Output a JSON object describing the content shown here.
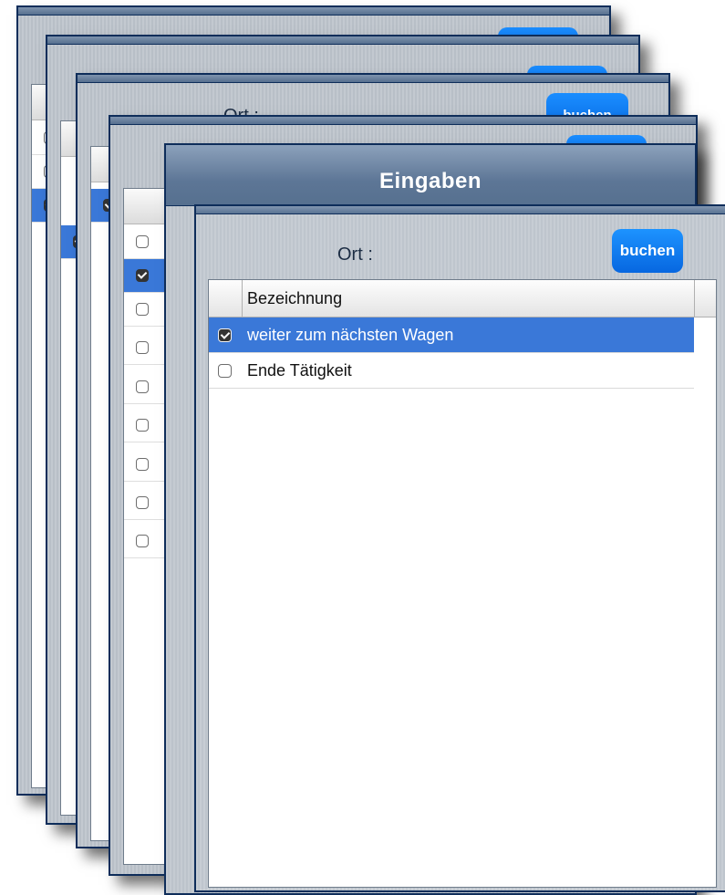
{
  "window_title": "Eingaben",
  "form": {
    "location_label": "Ort :",
    "book_button": "buchen"
  },
  "list": {
    "column_header": "Bezeichnung",
    "rows": [
      {
        "label": "weiter zum nächsten Wagen",
        "checked": true
      },
      {
        "label": "Ende Tätigkeit",
        "checked": false
      }
    ]
  },
  "background_windows": {
    "location_label_partial": "Ort :",
    "book_button_partial": "buchen"
  },
  "colors": {
    "accent_blue": "#0767e0",
    "selection": "#3a78d8",
    "frame": "#0e2d5a",
    "titlebar": "#5d7696"
  }
}
